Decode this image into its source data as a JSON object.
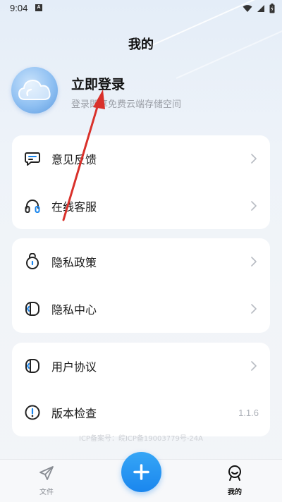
{
  "status_bar": {
    "time": "9:04",
    "notification_badge": "A"
  },
  "header": {
    "title": "我的"
  },
  "profile": {
    "login_title": "立即登录",
    "login_subtitle": "登录即享免费云端存储空间"
  },
  "menu": {
    "card1": [
      {
        "label": "意见反馈",
        "icon": "feedback-icon"
      },
      {
        "label": "在线客服",
        "icon": "headset-icon"
      }
    ],
    "card2": [
      {
        "label": "隐私政策",
        "icon": "privacy-policy-icon"
      },
      {
        "label": "隐私中心",
        "icon": "privacy-center-icon"
      }
    ],
    "card3": [
      {
        "label": "用户协议",
        "icon": "user-agreement-icon"
      },
      {
        "label": "版本检查",
        "icon": "version-check-icon",
        "value": "1.1.6"
      }
    ]
  },
  "footer": {
    "icp_text": "ICP备案号：皖ICP备19003779号-24A"
  },
  "bottom_nav": {
    "files_label": "文件",
    "mine_label": "我的",
    "active": "mine"
  },
  "colors": {
    "accent": "#1a86ee",
    "annotation": "#d9312b",
    "muted_text": "#9a9ea6"
  }
}
